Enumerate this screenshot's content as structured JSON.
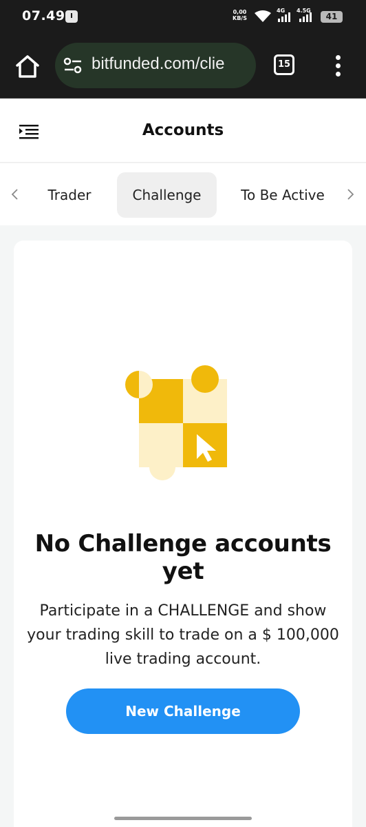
{
  "status_bar": {
    "time": "07.49",
    "net_speed_value": "0,00",
    "net_speed_unit": "KB/S",
    "signal1_label": "4G",
    "signal2_label": "4.5G",
    "battery": "41"
  },
  "browser": {
    "url": "bitfunded.com/clie",
    "tab_count": "15"
  },
  "header": {
    "title": "Accounts"
  },
  "tabs": [
    {
      "label": "Trader",
      "active": false
    },
    {
      "label": "Challenge",
      "active": true
    },
    {
      "label": "To Be Active",
      "active": false
    }
  ],
  "empty_state": {
    "title": "No Challenge accounts yet",
    "description_lines": [
      "Participate in a CHALLENGE and show",
      "your trading skill to trade on a $ 100,000",
      "live trading account."
    ],
    "button_label": "New Challenge"
  },
  "colors": {
    "accent": "#2291f4",
    "illustration_primary": "#f0b90b",
    "illustration_light": "#fdf0c8"
  },
  "icons": {
    "home": "home-icon",
    "site_settings": "tune-icon",
    "menu": "menu-icon",
    "more": "more-vertical-icon",
    "prev": "chevron-left-icon",
    "next": "chevron-right-icon"
  }
}
